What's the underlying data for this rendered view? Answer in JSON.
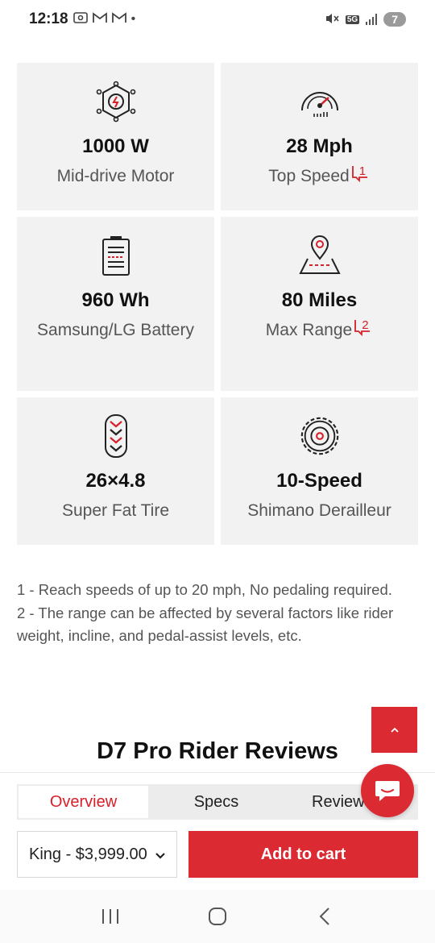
{
  "status_bar": {
    "time": "12:18",
    "notification_count": "7",
    "network": "5G"
  },
  "specs": [
    {
      "icon": "motor-icon",
      "value": "1000 W",
      "label": "Mid-drive Motor",
      "footnote": ""
    },
    {
      "icon": "speedometer-icon",
      "value": "28 Mph",
      "label": "Top Speed",
      "footnote": "1"
    },
    {
      "icon": "battery-icon",
      "value": "960 Wh",
      "label": "Samsung/LG Battery",
      "footnote": ""
    },
    {
      "icon": "map-pin-icon",
      "value": "80 Miles",
      "label": "Max Range",
      "footnote": "2"
    },
    {
      "icon": "tire-icon",
      "value": "26×4.8",
      "label": "Super Fat Tire",
      "footnote": ""
    },
    {
      "icon": "gear-icon",
      "value": "10-Speed",
      "label": "Shimano Derailleur",
      "footnote": ""
    }
  ],
  "footnotes": [
    "1 - Reach speeds of up to 20 mph, No pedaling required.",
    "2 - The range can be affected by several factors like rider weight, incline, and pedal-assist levels, etc."
  ],
  "reviews_title": "D7 Pro Rider Reviews",
  "tabs": [
    "Overview",
    "Specs",
    "Reviews"
  ],
  "variant": {
    "selected": "King - $3,999.00"
  },
  "add_to_cart": "Add to cart",
  "colors": {
    "accent": "#dc2a33",
    "card_bg": "#f2f2f2"
  }
}
